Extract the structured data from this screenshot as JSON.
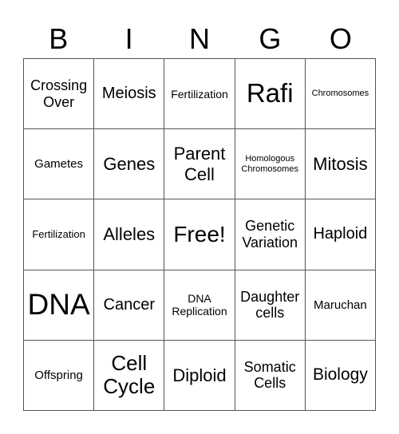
{
  "header": {
    "letters": [
      "B",
      "I",
      "N",
      "G",
      "O"
    ]
  },
  "board": {
    "rows": [
      [
        "Crossing Over",
        "Meiosis",
        "Fertilization",
        "Rafi",
        "Chromosomes"
      ],
      [
        "Gametes",
        "Genes",
        "Parent Cell",
        "Homologous Chromosomes",
        "Mitosis"
      ],
      [
        "Fertilization",
        "Alleles",
        "Free!",
        "Genetic Variation",
        "Haploid"
      ],
      [
        "DNA",
        "Cancer",
        "DNA Replication",
        "Daughter cells",
        "Maruchan"
      ],
      [
        "Offspring",
        "Cell Cycle",
        "Diploid",
        "Somatic Cells",
        "Biology"
      ]
    ],
    "free_space": "Free!"
  }
}
